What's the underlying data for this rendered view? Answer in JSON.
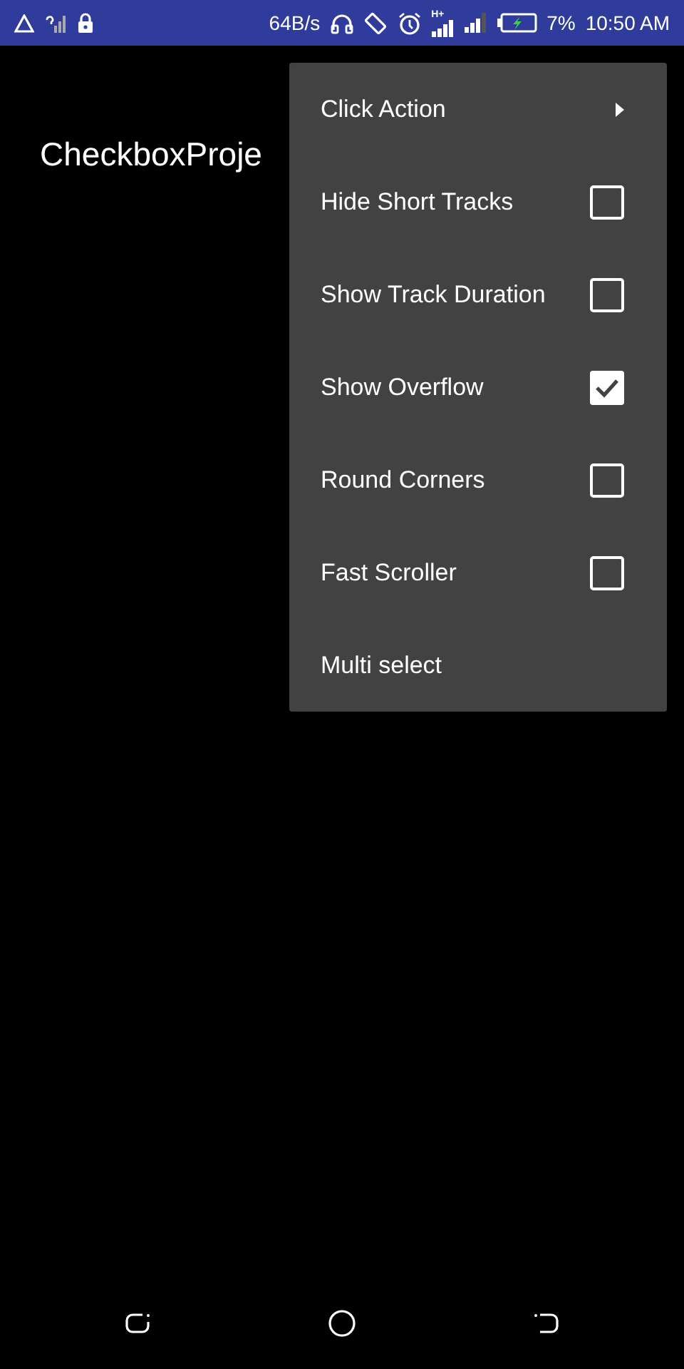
{
  "status_bar": {
    "speed": "64B/s",
    "network_type": "H+",
    "battery": "7%",
    "time": "10:50 AM"
  },
  "app_bar": {
    "title": "CheckboxProje"
  },
  "menu": {
    "items": [
      {
        "label": "Click Action",
        "kind": "submenu"
      },
      {
        "label": "Hide Short Tracks",
        "kind": "checkbox",
        "checked": false
      },
      {
        "label": "Show Track Duration",
        "kind": "checkbox",
        "checked": false
      },
      {
        "label": "Show Overflow",
        "kind": "checkbox",
        "checked": true
      },
      {
        "label": "Round Corners",
        "kind": "checkbox",
        "checked": false
      },
      {
        "label": "Fast Scroller",
        "kind": "checkbox",
        "checked": false
      },
      {
        "label": "Multi select",
        "kind": "plain"
      }
    ]
  }
}
